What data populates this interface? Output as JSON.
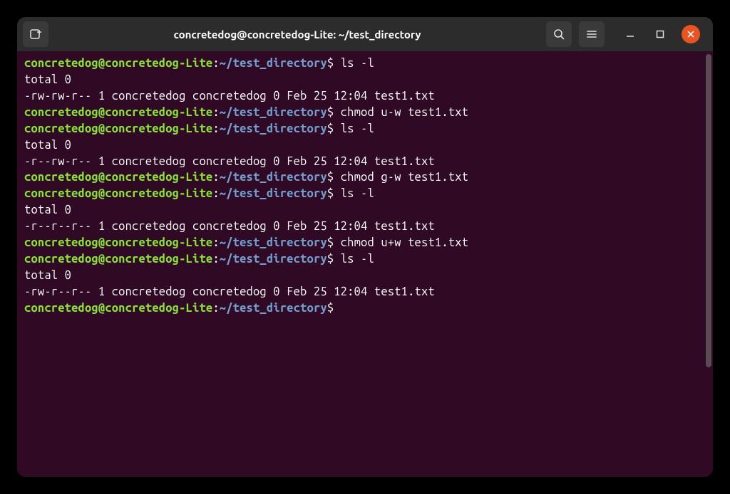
{
  "window": {
    "title": "concretedog@concretedog-Lite: ~/test_directory"
  },
  "prompt": {
    "userhost": "concretedog@concretedog-Lite",
    "colon": ":",
    "path": "~/test_directory",
    "dollar": "$"
  },
  "lines": [
    {
      "type": "prompt",
      "cmd": " ls -l"
    },
    {
      "type": "output",
      "text": "total 0"
    },
    {
      "type": "output",
      "text": "-rw-rw-r-- 1 concretedog concretedog 0 Feb 25 12:04 test1.txt"
    },
    {
      "type": "prompt",
      "cmd": " chmod u-w test1.txt"
    },
    {
      "type": "prompt",
      "cmd": " ls -l"
    },
    {
      "type": "output",
      "text": "total 0"
    },
    {
      "type": "output",
      "text": "-r--rw-r-- 1 concretedog concretedog 0 Feb 25 12:04 test1.txt"
    },
    {
      "type": "prompt",
      "cmd": " chmod g-w test1.txt"
    },
    {
      "type": "prompt",
      "cmd": " ls -l"
    },
    {
      "type": "output",
      "text": "total 0"
    },
    {
      "type": "output",
      "text": "-r--r--r-- 1 concretedog concretedog 0 Feb 25 12:04 test1.txt"
    },
    {
      "type": "prompt",
      "cmd": " chmod u+w test1.txt"
    },
    {
      "type": "prompt",
      "cmd": " ls -l"
    },
    {
      "type": "output",
      "text": "total 0"
    },
    {
      "type": "output",
      "text": "-rw-r--r-- 1 concretedog concretedog 0 Feb 25 12:04 test1.txt"
    },
    {
      "type": "prompt",
      "cmd": ""
    }
  ]
}
